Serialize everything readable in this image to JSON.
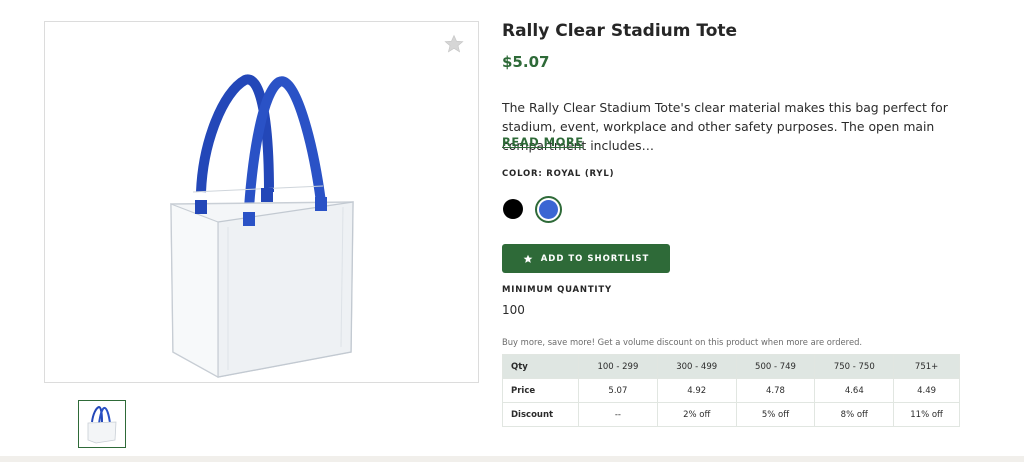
{
  "product": {
    "title": "Rally Clear Stadium Tote",
    "price": "$5.07",
    "description": "The Rally Clear Stadium Tote's clear material makes this bag perfect for stadium, event, workplace and other safety purposes. The open main compartment includes…",
    "read_more": "READ MORE"
  },
  "icons": {
    "favorite": "star-icon",
    "shortlist": "star-icon"
  },
  "color": {
    "label": "COLOR: ROYAL (RYL)",
    "options": [
      {
        "name": "black",
        "hex": "#000000",
        "selected": false
      },
      {
        "name": "royal",
        "hex": "#3b66d3",
        "selected": true
      }
    ],
    "accent": "#2e6a38"
  },
  "shortlist_button": "ADD TO SHORTLIST",
  "minimum_quantity": {
    "label": "MINIMUM QUANTITY",
    "value": "100"
  },
  "discount_note": "Buy more, save more! Get a volume discount on this product when more are ordered.",
  "pricing_table": {
    "headers": [
      "Qty",
      "100 - 299",
      "300 - 499",
      "500 - 749",
      "750 - 750",
      "751+"
    ],
    "rows": [
      {
        "label": "Price",
        "cells": [
          "5.07",
          "4.92",
          "4.78",
          "4.64",
          "4.49"
        ]
      },
      {
        "label": "Discount",
        "cells": [
          "--",
          "2% off",
          "5% off",
          "8% off",
          "11% off"
        ]
      }
    ]
  }
}
